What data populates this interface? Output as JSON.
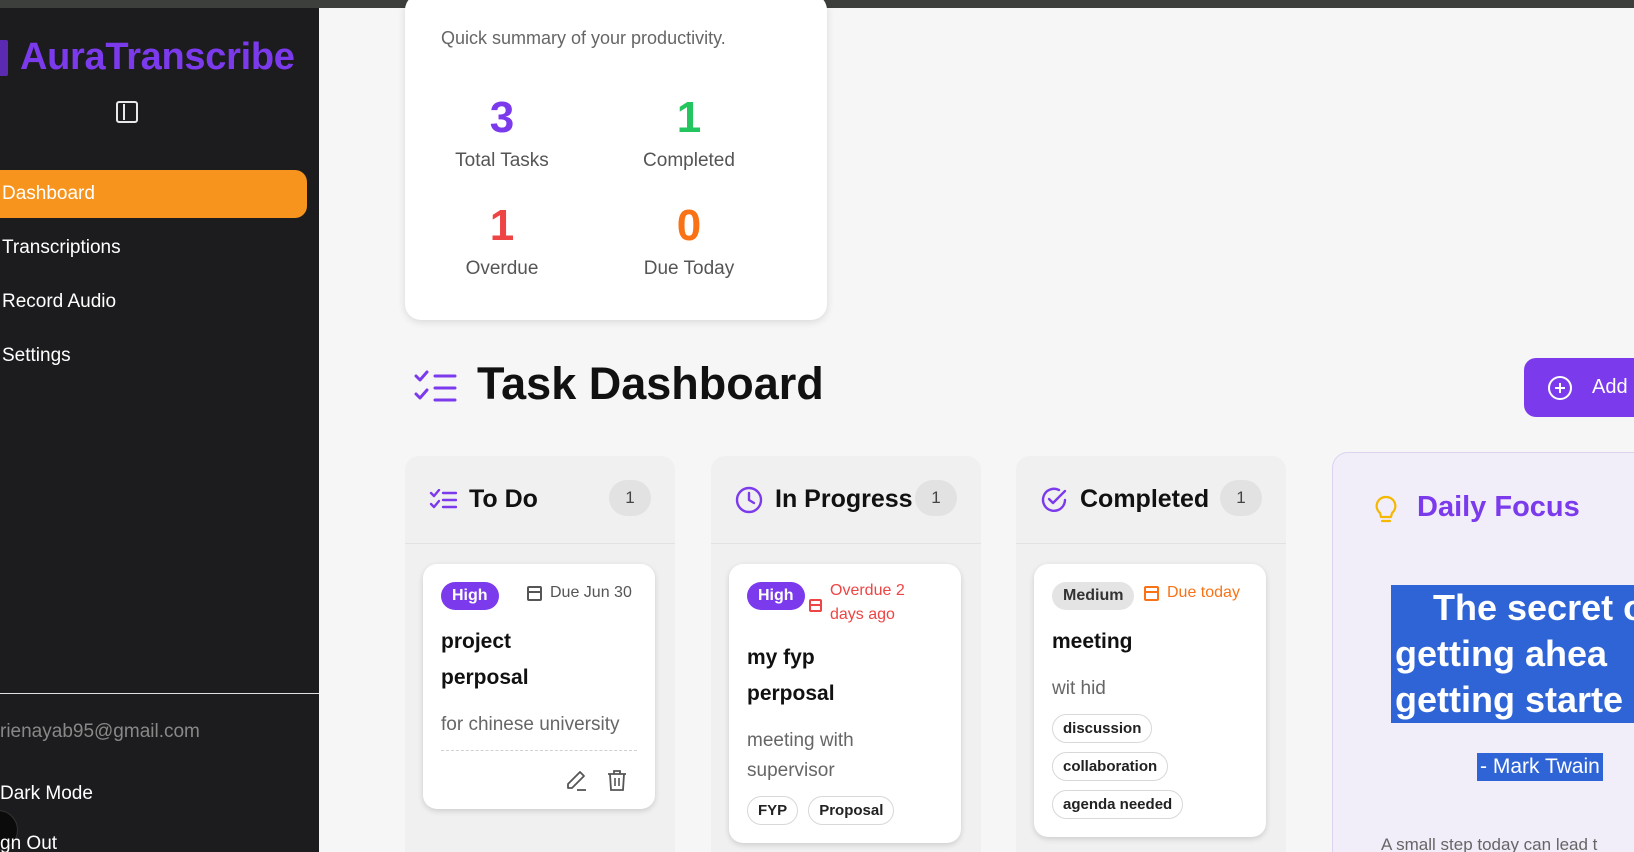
{
  "app": {
    "brand": "AuraTranscribe"
  },
  "sidebar": {
    "items": [
      {
        "label": "Dashboard"
      },
      {
        "label": "Transcriptions"
      },
      {
        "label": "Record Audio"
      },
      {
        "label": "Settings"
      }
    ],
    "email": "rienayab95@gmail.com",
    "dark_mode": "Dark Mode",
    "sign_out": "gn Out"
  },
  "summary": {
    "subtitle": "Quick summary of your productivity.",
    "stats": [
      {
        "value": "3",
        "label": "Total Tasks",
        "color": "#7c3aed"
      },
      {
        "value": "1",
        "label": "Completed",
        "color": "#22c55e"
      },
      {
        "value": "1",
        "label": "Overdue",
        "color": "#ef4444"
      },
      {
        "value": "0",
        "label": "Due Today",
        "color": "#f97316"
      }
    ]
  },
  "header": {
    "title": "Task Dashboard",
    "add_label": "Add"
  },
  "columns": [
    {
      "title": "To Do",
      "count": "1",
      "card": {
        "priority": "High",
        "due": "Due Jun 30",
        "title_line1": "project",
        "title_line2": "perposal",
        "desc": "for chinese university"
      }
    },
    {
      "title": "In Progress",
      "count": "1",
      "card": {
        "priority": "High",
        "due_line1": "Overdue 2",
        "due_line2": "days ago",
        "title_line1": "my fyp",
        "title_line2": "perposal",
        "desc_line1": "meeting with",
        "desc_line2": "supervisor",
        "tags": [
          "FYP",
          "Proposal"
        ]
      }
    },
    {
      "title": "Completed",
      "count": "1",
      "card": {
        "priority": "Medium",
        "due": "Due today",
        "title": "meeting",
        "desc": "wit hid",
        "tags": [
          "discussion",
          "collaboration",
          "agenda needed"
        ]
      }
    }
  ],
  "focus": {
    "title": "Daily Focus",
    "quote_line1": "The secret o",
    "quote_line2": "getting ahea",
    "quote_line3": "getting starte",
    "author": "- Mark Twain",
    "footer": "A small step today can lead t"
  },
  "colors": {
    "accent": "#7c3aed",
    "active_nav": "#f7941d",
    "overdue": "#ef4444",
    "due_today": "#f97316"
  }
}
